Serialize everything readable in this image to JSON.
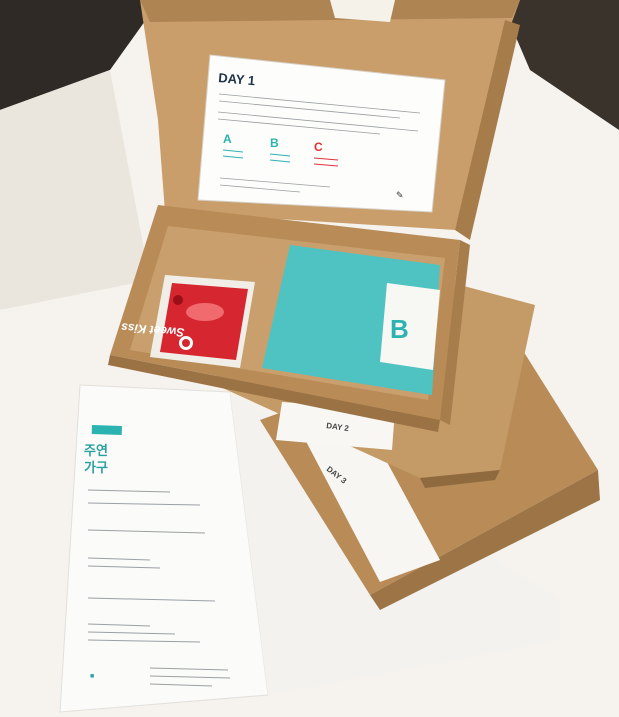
{
  "lid_card": {
    "title": "DAY 1",
    "options": [
      {
        "letter": "A",
        "color": "#2bb3b1"
      },
      {
        "letter": "B",
        "color": "#2bb3b1"
      },
      {
        "letter": "C",
        "color": "#e0303c"
      }
    ]
  },
  "tea_packet": {
    "brand_text": "Sweet Kiss"
  },
  "teal_card": {
    "letter": "B"
  },
  "box_labels": {
    "day2": "DAY 2",
    "day3": "DAY 3"
  },
  "worksheet": {
    "heading_line1": "주연",
    "heading_line2": "가구"
  },
  "colors": {
    "cardboard": "#c79d6c",
    "cardboard_dark": "#a8804f",
    "teal": "#49c3c3",
    "accent_red": "#e0303c",
    "background": "#f3efe8"
  }
}
